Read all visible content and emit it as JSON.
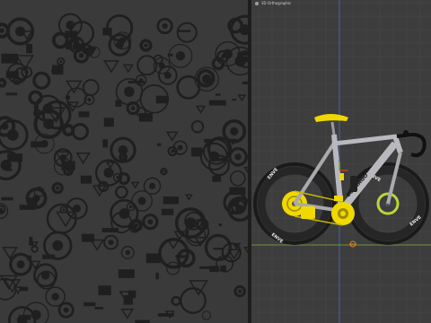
{
  "uv_editor": {
    "background_color": "#3a3a3a",
    "uv_island_color": "#1f1f1f"
  },
  "viewport": {
    "view_label": "3D Orthographic",
    "icons": {
      "view": "camera-icon"
    },
    "grid_color": "#4a4a4a",
    "axis_colors": {
      "x": "#b5403d",
      "y": "#7cae3b",
      "z": "#3f6fc2"
    },
    "model": {
      "brand_wheel_text": "ENVE",
      "brand_frame_text": "COLNAGO",
      "frame_color": "#b8b8be",
      "accent_color": "#f0d800",
      "tire_color": "#1a1a1a"
    }
  }
}
